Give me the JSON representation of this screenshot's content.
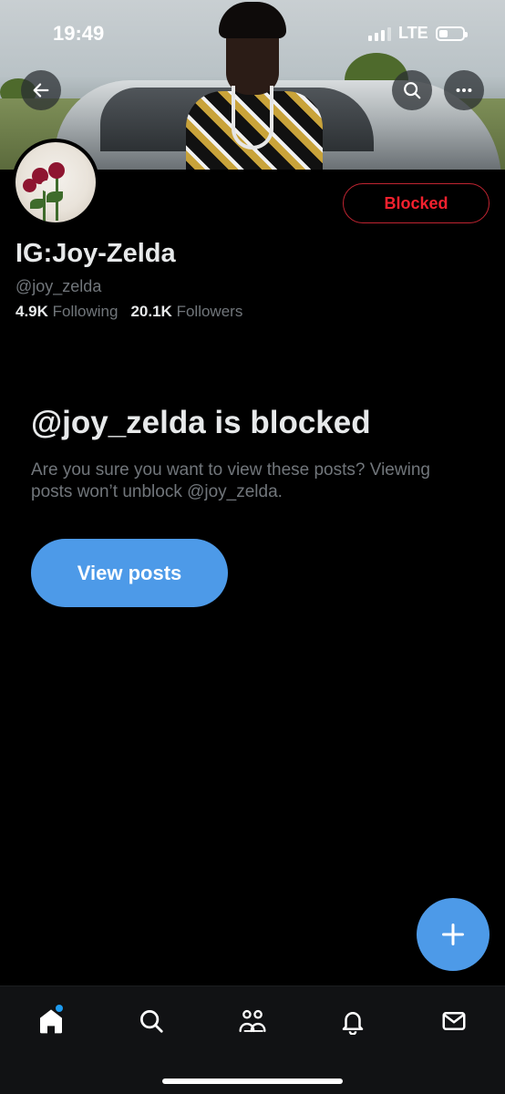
{
  "status_bar": {
    "time": "19:49",
    "network": "LTE",
    "battery_level": 0.4
  },
  "header": {
    "back_icon": "arrow-left-icon",
    "search_icon": "search-icon",
    "more_icon": "more-horizontal-icon"
  },
  "profile": {
    "display_name": "IG:Joy-Zelda",
    "handle": "@joy_zelda",
    "following_count": "4.9K",
    "following_label": "Following",
    "followers_count": "20.1K",
    "followers_label": "Followers",
    "blocked_button_label": "Blocked"
  },
  "blocked_notice": {
    "title": "@joy_zelda is blocked",
    "description": "Are you sure you want to view these posts? Viewing posts won’t unblock @joy_zelda.",
    "view_button_label": "View posts"
  },
  "fab": {
    "icon": "plus-icon"
  },
  "tabbar": {
    "items": [
      {
        "name": "home",
        "icon": "home-icon",
        "active": true,
        "has_dot": true
      },
      {
        "name": "search",
        "icon": "search-icon",
        "active": false
      },
      {
        "name": "communities",
        "icon": "people-icon",
        "active": false
      },
      {
        "name": "notifications",
        "icon": "bell-icon",
        "active": false
      },
      {
        "name": "messages",
        "icon": "mail-icon",
        "active": false
      }
    ]
  },
  "colors": {
    "accent": "#4d9ae8",
    "blocked_red": "#f4212e",
    "muted_text": "#71767b",
    "primary_text": "#e7e9ea",
    "background": "#000000"
  }
}
